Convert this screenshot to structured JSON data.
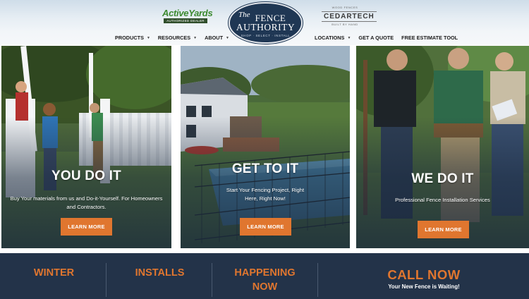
{
  "header": {
    "logo_left": {
      "name": "ActiveYards",
      "tagline": "AUTHORIZED DEALER"
    },
    "logo_main": {
      "the": "The",
      "line1": "FENCE",
      "line2": "AUTHORITY",
      "tagline": "SHOP · SELECT · INSTALL"
    },
    "logo_right": {
      "top": "WOOD FENCES",
      "name": "CEDARTECH",
      "bottom": "BUILT BY HAND"
    }
  },
  "nav": {
    "left": [
      {
        "label": "PRODUCTS",
        "has_dropdown": true
      },
      {
        "label": "RESOURCES",
        "has_dropdown": true
      },
      {
        "label": "ABOUT",
        "has_dropdown": true
      }
    ],
    "right": [
      {
        "label": "LOCATIONS",
        "has_dropdown": true
      },
      {
        "label": "GET A QUOTE",
        "has_dropdown": false
      },
      {
        "label": "FREE ESTIMATE TOOL",
        "has_dropdown": false
      }
    ]
  },
  "panels": [
    {
      "title": "YOU DO IT",
      "description": "Buy Your materials from us and Do-it-Yourself. For Homeowners and Contractors.",
      "button": "LEARN MORE"
    },
    {
      "title": "GET TO IT",
      "description": "Start Your Fencing Project, Right Here, Right Now!",
      "button": "LEARN MORE"
    },
    {
      "title": "WE DO IT",
      "description": "Professional Fence Installation Services",
      "button": "LEARN MORE"
    }
  ],
  "footer": {
    "items": [
      {
        "line1": "WINTER",
        "line2": ""
      },
      {
        "line1": "INSTALLS",
        "line2": ""
      },
      {
        "line1": "HAPPENING",
        "line2": "NOW"
      }
    ],
    "call_now": "CALL NOW",
    "call_sub": "Your New Fence is Waiting!"
  },
  "colors": {
    "accent": "#e0762f",
    "navy": "#233349",
    "logo_navy": "#1f3754",
    "activeyards_green": "#3c8a2f"
  }
}
